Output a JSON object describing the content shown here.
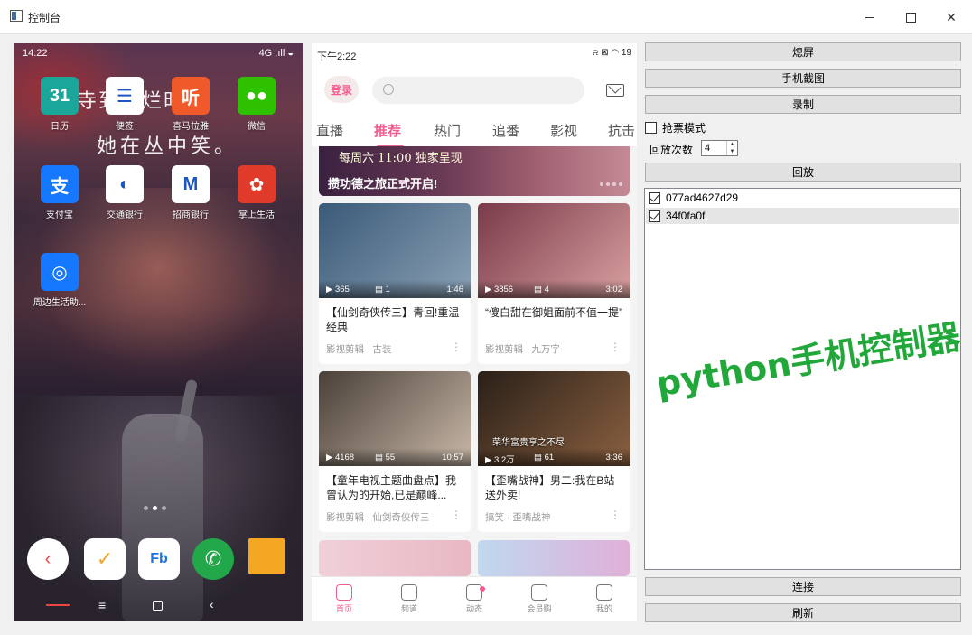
{
  "window": {
    "title": "控制台"
  },
  "phone1": {
    "status": {
      "time": "14:22",
      "right": "4G .ıll ◒"
    },
    "wallpaper_text_1": "寺到花烂时",
    "wallpaper_text_2": "她在丛中笑。",
    "apps": [
      {
        "label": "日历",
        "icon_text": "31",
        "color": "#1aa79a",
        "icon": "calendar-icon"
      },
      {
        "label": "便签",
        "icon_text": "☰",
        "color": "#ffffff",
        "icon": "notes-icon"
      },
      {
        "label": "喜马拉雅",
        "icon_text": "听",
        "color": "#f05a2a",
        "icon": "himalaya-icon"
      },
      {
        "label": "微信",
        "icon_text": "●●",
        "color": "#2dc100",
        "icon": "wechat-icon"
      },
      {
        "label": "支付宝",
        "icon_text": "支",
        "color": "#1677ff",
        "icon": "alipay-icon"
      },
      {
        "label": "交通银行",
        "icon_text": "◐",
        "color": "#ffffff",
        "icon": "bank-icon"
      },
      {
        "label": "招商银行",
        "icon_text": "M",
        "color": "#ffffff",
        "icon": "cmb-icon"
      },
      {
        "label": "掌上生活",
        "icon_text": "✿",
        "color": "#e03a2a",
        "icon": "lifestyle-icon"
      },
      {
        "label": "周边生活助...",
        "icon_text": "◎",
        "color": "#1677ff",
        "icon": "nearby-icon"
      }
    ],
    "dock": [
      "‹",
      "✓",
      "Fb",
      "✆",
      "▰"
    ]
  },
  "phone2": {
    "status": {
      "time": "下午2:22",
      "right": "⍾ ⊠ ◠ 19"
    },
    "login_label": "登录",
    "tabs": [
      {
        "label": "直播",
        "active": false
      },
      {
        "label": "推荐",
        "active": true
      },
      {
        "label": "热门",
        "active": false
      },
      {
        "label": "追番",
        "active": false
      },
      {
        "label": "影视",
        "active": false
      },
      {
        "label": "抗击",
        "active": false
      }
    ],
    "banner": {
      "subtitle": "每周六 11:00 独家呈现",
      "title": "攒功德之旅正式开启!"
    },
    "cards": [
      {
        "views": "365",
        "danmaku": "1",
        "duration": "1:46",
        "title": "【仙剑奇侠传三】青回!重温经典",
        "tag": "影视剪辑 · 古装",
        "colors": [
          "#3a5a78",
          "#8aa0b4"
        ]
      },
      {
        "views": "3856",
        "danmaku": "4",
        "duration": "3:02",
        "title": "“傻白甜在御姐面前不值一提”",
        "tag": "影视剪辑 · 九万字",
        "colors": [
          "#7a3a4a",
          "#d8a0a0"
        ]
      },
      {
        "views": "4168",
        "danmaku": "55",
        "duration": "10:57",
        "title": "【童年电视主题曲盘点】我曾认为的开始,已是巅峰...",
        "tag": "影视剪辑 · 仙剑奇侠传三",
        "colors": [
          "#4a4038",
          "#c8b8a8"
        ]
      },
      {
        "views": "3.2万",
        "danmaku": "61",
        "duration": "3:36",
        "title": "【歪嘴战神】男二:我在B站送外卖!",
        "tag": "搞笑 · 歪嘴战神",
        "colors": [
          "#2a2018",
          "#8a6040"
        ],
        "overlay": "荣华富贵享之不尽"
      }
    ],
    "bottom_nav": [
      {
        "label": "首页",
        "active": true
      },
      {
        "label": "频道",
        "active": false
      },
      {
        "label": "动态",
        "active": false
      },
      {
        "label": "会员购",
        "active": false
      },
      {
        "label": "我的",
        "active": false
      }
    ]
  },
  "controls": {
    "screen_off": "熄屏",
    "screenshot": "手机截图",
    "record": "录制",
    "grab_mode": "抢票模式",
    "replay_count_label": "回放次数",
    "replay_count": "4",
    "replay": "回放",
    "devices": [
      {
        "id": "077ad4627d29",
        "checked": true,
        "selected": false
      },
      {
        "id": "34f0fa0f",
        "checked": true,
        "selected": true
      }
    ],
    "connect": "连接",
    "refresh": "刷新",
    "watermark": "python手机控制器"
  }
}
